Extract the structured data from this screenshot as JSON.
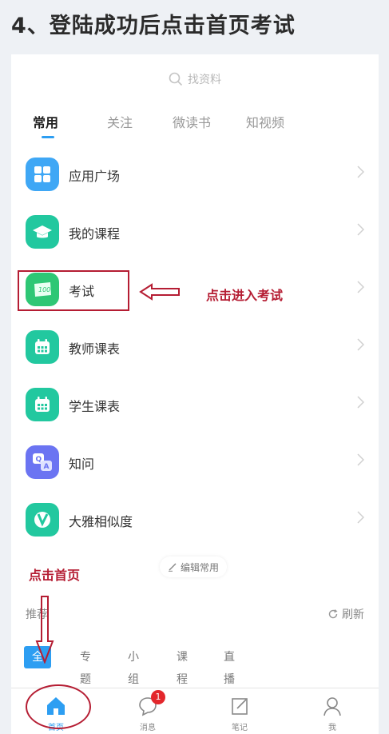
{
  "heading": "4、登陆成功后点击首页考试",
  "search": {
    "placeholder": "找资料"
  },
  "tabs": [
    {
      "label": "常用",
      "active": true
    },
    {
      "label": "关注"
    },
    {
      "label": "微读书"
    },
    {
      "label": "知视频"
    }
  ],
  "menu": [
    {
      "label": "应用广场",
      "icon": "grid-icon",
      "color": "#3fa7f5"
    },
    {
      "label": "我的课程",
      "icon": "graduation-cap-icon",
      "color": "#22c89f"
    },
    {
      "label": "考试",
      "icon": "exam-paper-icon",
      "color": "#2ec775"
    },
    {
      "label": "教师课表",
      "icon": "calendar-icon",
      "color": "#22c89f"
    },
    {
      "label": "学生课表",
      "icon": "calendar-icon",
      "color": "#22c89f"
    },
    {
      "label": "知问",
      "icon": "qa-icon",
      "color": "#6b74f2"
    },
    {
      "label": "大雅相似度",
      "icon": "similarity-icon",
      "color": "#22c89f"
    }
  ],
  "annotations": {
    "enter_exam": "点击进入考试",
    "click_home": "点击首页"
  },
  "edit_common": "编辑常用",
  "recommend": {
    "label": "推荐",
    "refresh": "刷新"
  },
  "chips": [
    {
      "label": "全部",
      "active": true
    },
    {
      "label": "专题"
    },
    {
      "label": "小组"
    },
    {
      "label": "课程"
    },
    {
      "label": "直播"
    }
  ],
  "bottom_nav": [
    {
      "label": "首页",
      "icon": "home-icon",
      "active": true
    },
    {
      "label": "消息",
      "icon": "chat-icon",
      "badge": "1"
    },
    {
      "label": "笔记",
      "icon": "note-icon"
    },
    {
      "label": "我",
      "icon": "person-icon"
    }
  ],
  "colors": {
    "accent": "#2d9ef2",
    "annotation": "#b51d33",
    "badge": "#e3272c"
  }
}
